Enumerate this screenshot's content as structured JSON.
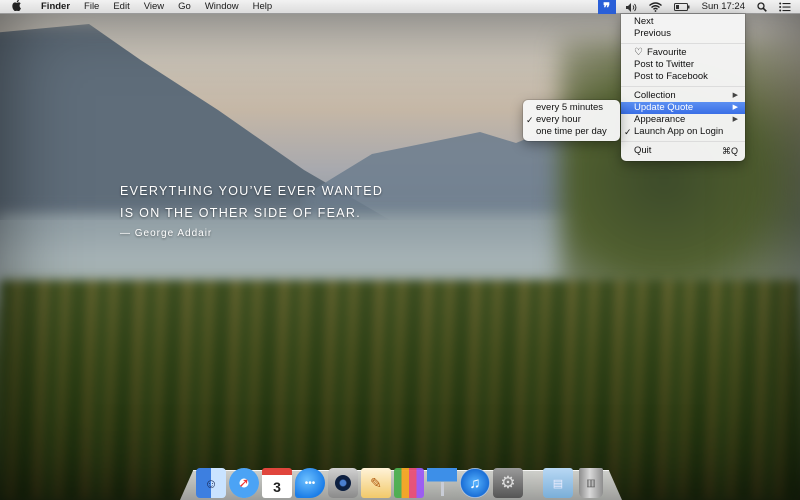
{
  "menubar": {
    "apple_icon": "",
    "app_name": "Finder",
    "menus": [
      "File",
      "Edit",
      "View",
      "Go",
      "Window",
      "Help"
    ],
    "status": {
      "quote_app_icon": "❞",
      "volume_icon": "🔈",
      "wifi_icon": "wifi",
      "battery_icon": "battery",
      "clock": "Sun 17:24",
      "spotlight_icon": "⌕",
      "notification_icon": "≡"
    }
  },
  "quote": {
    "lines": [
      "EVERYTHING YOU’VE EVER WANTED",
      "IS ON THE OTHER SIDE OF FEAR."
    ],
    "author": "— George Addair"
  },
  "quote_menu": {
    "items": [
      {
        "label": "Next"
      },
      {
        "label": "Previous"
      },
      {
        "label": "Favourite",
        "icon": "♡"
      },
      {
        "label": "Post to Twitter"
      },
      {
        "label": "Post to Facebook"
      },
      {
        "label": "Collection",
        "submenu": true
      },
      {
        "label": "Update Quote",
        "submenu": true,
        "highlighted": true
      },
      {
        "label": "Appearance",
        "submenu": true
      },
      {
        "label": "Launch App on Login",
        "checked": true
      },
      {
        "label": "Quit",
        "shortcut": "⌘Q"
      }
    ],
    "arrow_glyph": "▶",
    "check_glyph": "✓"
  },
  "update_quote_submenu": {
    "items": [
      {
        "label": "every 5 minutes",
        "checked": false
      },
      {
        "label": "every hour",
        "checked": true
      },
      {
        "label": "one time per day",
        "checked": false
      }
    ]
  },
  "dock": {
    "apps": [
      {
        "name": "Finder",
        "glyph": "☺",
        "running": true
      },
      {
        "name": "Safari",
        "glyph": "➚",
        "running": true
      },
      {
        "name": "Calendar",
        "glyph": "3"
      },
      {
        "name": "Messages",
        "glyph": "•••"
      },
      {
        "name": "FaceTime",
        "glyph": ""
      },
      {
        "name": "Pages",
        "glyph": "✎"
      },
      {
        "name": "Numbers",
        "glyph": ""
      },
      {
        "name": "Keynote",
        "glyph": "▭"
      },
      {
        "name": "iTunes",
        "glyph": "♫",
        "running": true
      },
      {
        "name": "System Preferences",
        "glyph": "⚙"
      },
      {
        "name": "Documents Folder",
        "glyph": "▤"
      },
      {
        "name": "Trash",
        "glyph": "▥"
      }
    ]
  }
}
